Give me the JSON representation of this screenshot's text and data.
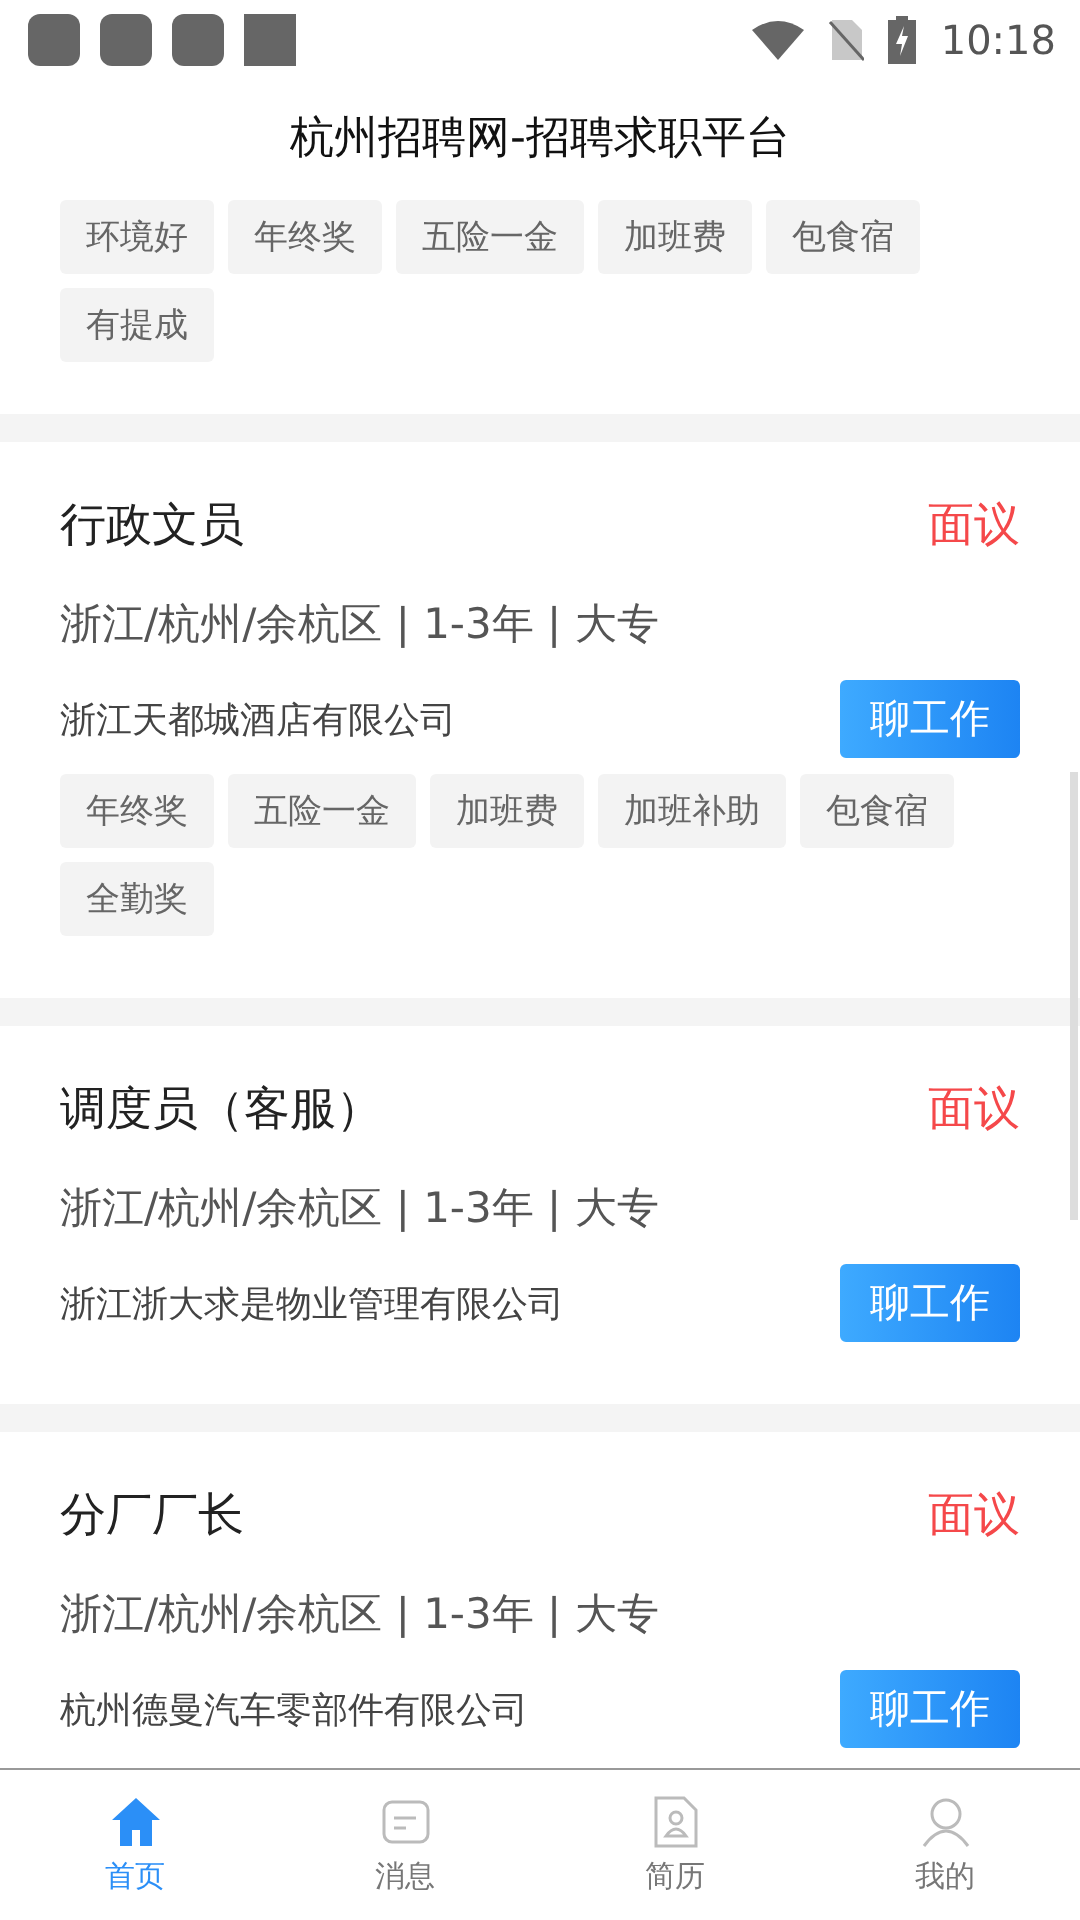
{
  "status_bar": {
    "time": "10:18"
  },
  "header": {
    "title": "杭州招聘网-招聘求职平台"
  },
  "jobs": [
    {
      "tags": [
        "环境好",
        "年终奖",
        "五险一金",
        "加班费",
        "包食宿",
        "有提成"
      ]
    },
    {
      "title": "行政文员",
      "salary": "面议",
      "location": "浙江/杭州/余杭区 | 1-3年 | 大专",
      "company": "浙江天都城酒店有限公司",
      "button": "聊工作",
      "tags": [
        "年终奖",
        "五险一金",
        "加班费",
        "加班补助",
        "包食宿",
        "全勤奖"
      ]
    },
    {
      "title": "调度员（客服）",
      "salary": "面议",
      "location": "浙江/杭州/余杭区 | 1-3年 | 大专",
      "company": "浙江浙大求是物业管理有限公司",
      "button": "聊工作"
    },
    {
      "title": "分厂厂长",
      "salary": "面议",
      "location": "浙江/杭州/余杭区 | 1-3年 | 大专",
      "company": "杭州德曼汽车零部件有限公司",
      "button": "聊工作"
    }
  ],
  "tab_bar": [
    {
      "label": "首页",
      "kind": "home",
      "selected": true
    },
    {
      "label": "消息",
      "kind": "message",
      "selected": false
    },
    {
      "label": "简历",
      "kind": "resume",
      "selected": false
    },
    {
      "label": "我的",
      "kind": "profile",
      "selected": false
    }
  ]
}
